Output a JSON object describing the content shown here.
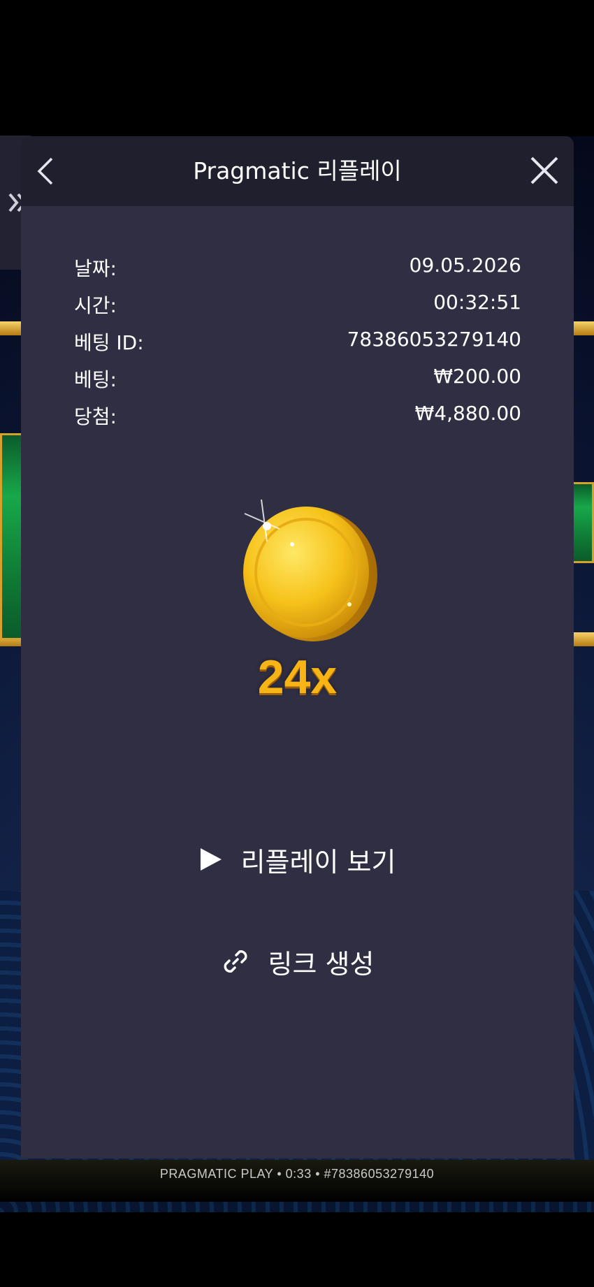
{
  "modal": {
    "title": "Pragmatic 리플레이"
  },
  "details": [
    {
      "label": "날짜:",
      "value": "09.05.2026"
    },
    {
      "label": "시간:",
      "value": "00:32:51"
    },
    {
      "label": "베팅 ID:",
      "value": "78386053279140"
    },
    {
      "label": "베팅:",
      "value": "₩200.00"
    },
    {
      "label": "당첨:",
      "value": "₩4,880.00"
    }
  ],
  "result": {
    "multiplier": "24x"
  },
  "actions": {
    "watch_replay": "리플레이 보기",
    "create_link": "링크 생성"
  },
  "footer": {
    "caption": "PRAGMATIC PLAY • 0:33 • #78386053279140"
  },
  "icons": {
    "back": "chevron-left-icon",
    "close": "close-icon",
    "play": "play-icon",
    "link": "link-icon",
    "side": "double-chevron-right-icon"
  },
  "colors": {
    "modal_bg": "#2f2e42",
    "header_bg": "#201f2e",
    "accent_gold": "#f7b417"
  }
}
